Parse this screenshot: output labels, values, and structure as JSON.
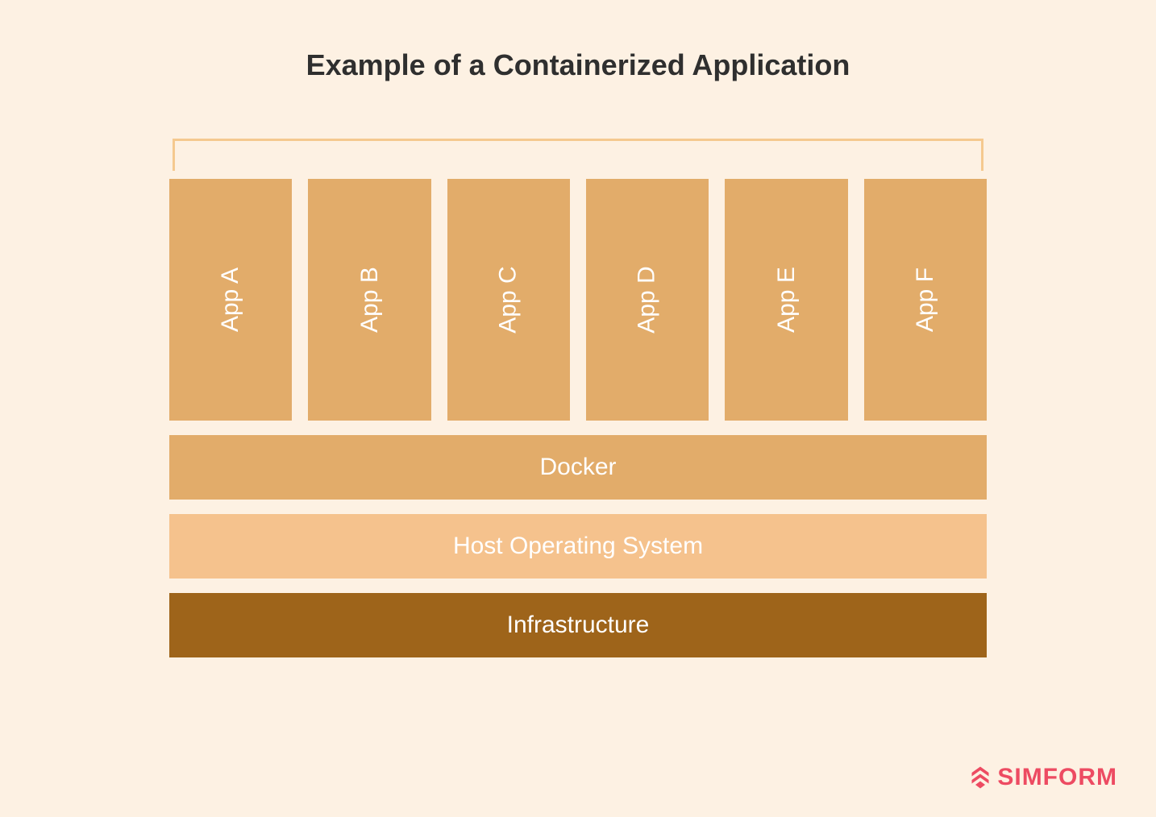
{
  "title": "Example of a Containerized Application",
  "apps": {
    "items": [
      {
        "label": "App A"
      },
      {
        "label": "App B"
      },
      {
        "label": "App C"
      },
      {
        "label": "App D"
      },
      {
        "label": "App E"
      },
      {
        "label": "App F"
      }
    ]
  },
  "layers": {
    "docker": "Docker",
    "host": "Host Operating System",
    "infra": "Infrastructure"
  },
  "brand": {
    "name": "SIMFORM"
  },
  "colors": {
    "background": "#fdf1e3",
    "apps": "#e2ac6a",
    "docker": "#e2ac6a",
    "host": "#f5c28d",
    "infra": "#9e641a",
    "bracket": "#f5c98f",
    "brand": "#ed4b62",
    "title": "#2f2f2f"
  }
}
